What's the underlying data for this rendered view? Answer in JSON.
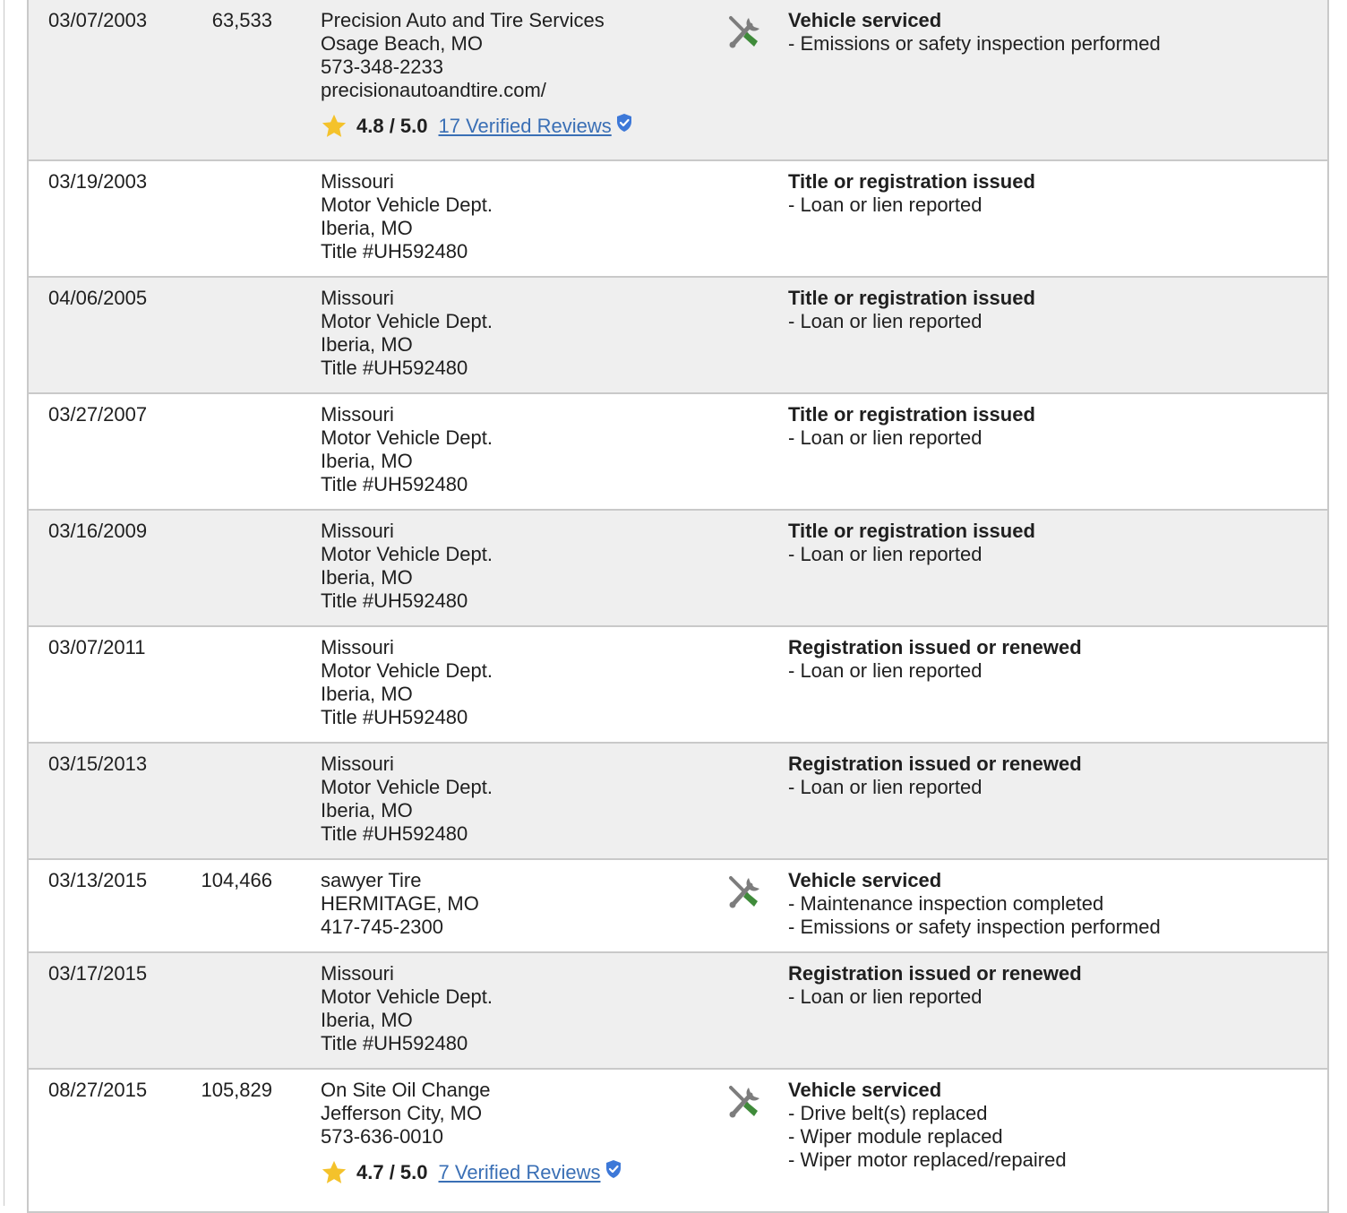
{
  "records": [
    {
      "date": "03/07/2003",
      "mileage": "63,533",
      "source": [
        "Precision Auto and Tire Services",
        "Osage Beach, MO",
        "573-348-2233",
        "precisionautoandtire.com/"
      ],
      "rating": {
        "score": "4.8 / 5.0",
        "reviews": "17 Verified Reviews"
      },
      "icon": "wrench-screwdriver-icon",
      "headline": "Vehicle serviced",
      "details": [
        "- Emissions or safety inspection performed"
      ]
    },
    {
      "date": "03/19/2003",
      "mileage": "",
      "source": [
        "Missouri",
        "Motor Vehicle Dept.",
        "Iberia, MO",
        "Title #UH592480"
      ],
      "headline": "Title or registration issued",
      "details": [
        "- Loan or lien reported"
      ]
    },
    {
      "date": "04/06/2005",
      "mileage": "",
      "source": [
        "Missouri",
        "Motor Vehicle Dept.",
        "Iberia, MO",
        "Title #UH592480"
      ],
      "headline": "Title or registration issued",
      "details": [
        "- Loan or lien reported"
      ]
    },
    {
      "date": "03/27/2007",
      "mileage": "",
      "source": [
        "Missouri",
        "Motor Vehicle Dept.",
        "Iberia, MO",
        "Title #UH592480"
      ],
      "headline": "Title or registration issued",
      "details": [
        "- Loan or lien reported"
      ]
    },
    {
      "date": "03/16/2009",
      "mileage": "",
      "source": [
        "Missouri",
        "Motor Vehicle Dept.",
        "Iberia, MO",
        "Title #UH592480"
      ],
      "headline": "Title or registration issued",
      "details": [
        "- Loan or lien reported"
      ]
    },
    {
      "date": "03/07/2011",
      "mileage": "",
      "source": [
        "Missouri",
        "Motor Vehicle Dept.",
        "Iberia, MO",
        "Title #UH592480"
      ],
      "headline": "Registration issued or renewed",
      "details": [
        "- Loan or lien reported"
      ]
    },
    {
      "date": "03/15/2013",
      "mileage": "",
      "source": [
        "Missouri",
        "Motor Vehicle Dept.",
        "Iberia, MO",
        "Title #UH592480"
      ],
      "headline": "Registration issued or renewed",
      "details": [
        "- Loan or lien reported"
      ]
    },
    {
      "date": "03/13/2015",
      "mileage": "104,466",
      "source": [
        "sawyer Tire",
        "HERMITAGE, MO",
        "417-745-2300"
      ],
      "icon": "wrench-screwdriver-icon",
      "headline": "Vehicle serviced",
      "details": [
        "- Maintenance inspection completed",
        "- Emissions or safety inspection performed"
      ]
    },
    {
      "date": "03/17/2015",
      "mileage": "",
      "source": [
        "Missouri",
        "Motor Vehicle Dept.",
        "Iberia, MO",
        "Title #UH592480"
      ],
      "headline": "Registration issued or renewed",
      "details": [
        "- Loan or lien reported"
      ]
    },
    {
      "date": "08/27/2015",
      "mileage": "105,829",
      "source": [
        "On Site Oil Change",
        "Jefferson City, MO",
        "573-636-0010"
      ],
      "rating": {
        "score": "4.7 / 5.0",
        "reviews": "7 Verified Reviews"
      },
      "icon": "wrench-screwdriver-icon",
      "headline": "Vehicle serviced",
      "details": [
        "- Drive belt(s) replaced",
        "- Wiper module replaced",
        "- Wiper motor replaced/repaired"
      ]
    }
  ],
  "colors": {
    "row_shade": "#efefef",
    "border": "#c9c9c9",
    "link": "#3a6fb5",
    "star": "#f4c22b",
    "shield": "#3d78d8",
    "tool_gray": "#7d7d7d",
    "tool_green": "#3f8b3a"
  }
}
